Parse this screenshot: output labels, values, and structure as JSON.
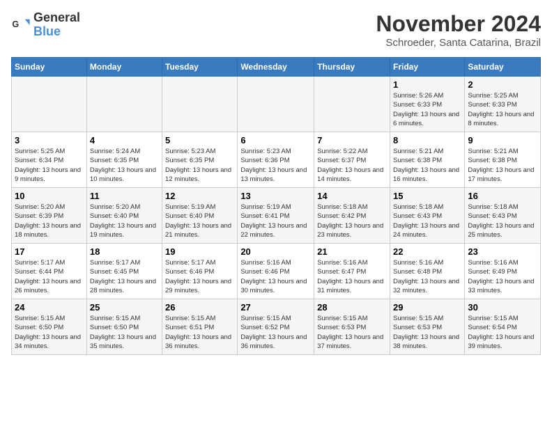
{
  "header": {
    "logo_line1": "General",
    "logo_line2": "Blue",
    "month": "November 2024",
    "location": "Schroeder, Santa Catarina, Brazil"
  },
  "weekdays": [
    "Sunday",
    "Monday",
    "Tuesday",
    "Wednesday",
    "Thursday",
    "Friday",
    "Saturday"
  ],
  "weeks": [
    [
      {
        "day": "",
        "info": ""
      },
      {
        "day": "",
        "info": ""
      },
      {
        "day": "",
        "info": ""
      },
      {
        "day": "",
        "info": ""
      },
      {
        "day": "",
        "info": ""
      },
      {
        "day": "1",
        "info": "Sunrise: 5:26 AM\nSunset: 6:33 PM\nDaylight: 13 hours and 6 minutes."
      },
      {
        "day": "2",
        "info": "Sunrise: 5:25 AM\nSunset: 6:33 PM\nDaylight: 13 hours and 8 minutes."
      }
    ],
    [
      {
        "day": "3",
        "info": "Sunrise: 5:25 AM\nSunset: 6:34 PM\nDaylight: 13 hours and 9 minutes."
      },
      {
        "day": "4",
        "info": "Sunrise: 5:24 AM\nSunset: 6:35 PM\nDaylight: 13 hours and 10 minutes."
      },
      {
        "day": "5",
        "info": "Sunrise: 5:23 AM\nSunset: 6:35 PM\nDaylight: 13 hours and 12 minutes."
      },
      {
        "day": "6",
        "info": "Sunrise: 5:23 AM\nSunset: 6:36 PM\nDaylight: 13 hours and 13 minutes."
      },
      {
        "day": "7",
        "info": "Sunrise: 5:22 AM\nSunset: 6:37 PM\nDaylight: 13 hours and 14 minutes."
      },
      {
        "day": "8",
        "info": "Sunrise: 5:21 AM\nSunset: 6:38 PM\nDaylight: 13 hours and 16 minutes."
      },
      {
        "day": "9",
        "info": "Sunrise: 5:21 AM\nSunset: 6:38 PM\nDaylight: 13 hours and 17 minutes."
      }
    ],
    [
      {
        "day": "10",
        "info": "Sunrise: 5:20 AM\nSunset: 6:39 PM\nDaylight: 13 hours and 18 minutes."
      },
      {
        "day": "11",
        "info": "Sunrise: 5:20 AM\nSunset: 6:40 PM\nDaylight: 13 hours and 19 minutes."
      },
      {
        "day": "12",
        "info": "Sunrise: 5:19 AM\nSunset: 6:40 PM\nDaylight: 13 hours and 21 minutes."
      },
      {
        "day": "13",
        "info": "Sunrise: 5:19 AM\nSunset: 6:41 PM\nDaylight: 13 hours and 22 minutes."
      },
      {
        "day": "14",
        "info": "Sunrise: 5:18 AM\nSunset: 6:42 PM\nDaylight: 13 hours and 23 minutes."
      },
      {
        "day": "15",
        "info": "Sunrise: 5:18 AM\nSunset: 6:43 PM\nDaylight: 13 hours and 24 minutes."
      },
      {
        "day": "16",
        "info": "Sunrise: 5:18 AM\nSunset: 6:43 PM\nDaylight: 13 hours and 25 minutes."
      }
    ],
    [
      {
        "day": "17",
        "info": "Sunrise: 5:17 AM\nSunset: 6:44 PM\nDaylight: 13 hours and 26 minutes."
      },
      {
        "day": "18",
        "info": "Sunrise: 5:17 AM\nSunset: 6:45 PM\nDaylight: 13 hours and 28 minutes."
      },
      {
        "day": "19",
        "info": "Sunrise: 5:17 AM\nSunset: 6:46 PM\nDaylight: 13 hours and 29 minutes."
      },
      {
        "day": "20",
        "info": "Sunrise: 5:16 AM\nSunset: 6:46 PM\nDaylight: 13 hours and 30 minutes."
      },
      {
        "day": "21",
        "info": "Sunrise: 5:16 AM\nSunset: 6:47 PM\nDaylight: 13 hours and 31 minutes."
      },
      {
        "day": "22",
        "info": "Sunrise: 5:16 AM\nSunset: 6:48 PM\nDaylight: 13 hours and 32 minutes."
      },
      {
        "day": "23",
        "info": "Sunrise: 5:16 AM\nSunset: 6:49 PM\nDaylight: 13 hours and 33 minutes."
      }
    ],
    [
      {
        "day": "24",
        "info": "Sunrise: 5:15 AM\nSunset: 6:50 PM\nDaylight: 13 hours and 34 minutes."
      },
      {
        "day": "25",
        "info": "Sunrise: 5:15 AM\nSunset: 6:50 PM\nDaylight: 13 hours and 35 minutes."
      },
      {
        "day": "26",
        "info": "Sunrise: 5:15 AM\nSunset: 6:51 PM\nDaylight: 13 hours and 36 minutes."
      },
      {
        "day": "27",
        "info": "Sunrise: 5:15 AM\nSunset: 6:52 PM\nDaylight: 13 hours and 36 minutes."
      },
      {
        "day": "28",
        "info": "Sunrise: 5:15 AM\nSunset: 6:53 PM\nDaylight: 13 hours and 37 minutes."
      },
      {
        "day": "29",
        "info": "Sunrise: 5:15 AM\nSunset: 6:53 PM\nDaylight: 13 hours and 38 minutes."
      },
      {
        "day": "30",
        "info": "Sunrise: 5:15 AM\nSunset: 6:54 PM\nDaylight: 13 hours and 39 minutes."
      }
    ]
  ]
}
